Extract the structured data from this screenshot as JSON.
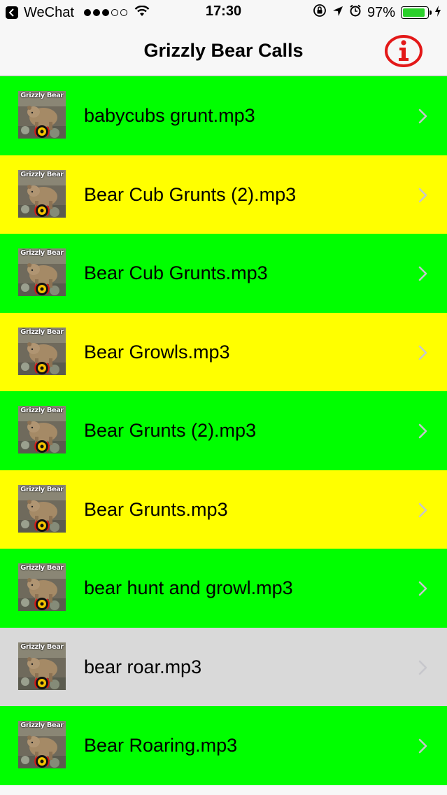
{
  "status_bar": {
    "back_app": "WeChat",
    "time": "17:30",
    "battery_percent": "97%",
    "battery_level": 0.97,
    "signal_bars": [
      1,
      1,
      1,
      0,
      0
    ]
  },
  "nav": {
    "title": "Grizzly Bear Calls",
    "info_icon": "info-icon"
  },
  "thumbnail_text": "Grizzly Bear",
  "list_items": [
    {
      "label": "babycubs grunt.mp3",
      "color": "#00ff00"
    },
    {
      "label": "Bear Cub Grunts (2).mp3",
      "color": "#ffff00"
    },
    {
      "label": "Bear Cub Grunts.mp3",
      "color": "#00ff00"
    },
    {
      "label": "Bear Growls.mp3",
      "color": "#ffff00"
    },
    {
      "label": "Bear Grunts (2).mp3",
      "color": "#00ff00"
    },
    {
      "label": "Bear Grunts.mp3",
      "color": "#ffff00"
    },
    {
      "label": "bear hunt and growl.mp3",
      "color": "#00ff00"
    },
    {
      "label": "bear roar.mp3",
      "color": "#d9d9d9"
    },
    {
      "label": "Bear Roaring.mp3",
      "color": "#00ff00"
    }
  ]
}
